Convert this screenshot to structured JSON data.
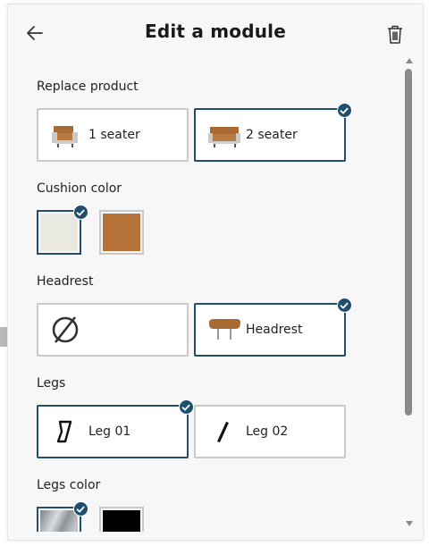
{
  "header": {
    "title": "Edit a module",
    "back_icon": "arrow-left-icon",
    "delete_icon": "trash-icon"
  },
  "sections": {
    "replace_product": {
      "label": "Replace product",
      "options": [
        {
          "label": "1 seater",
          "selected": false
        },
        {
          "label": "2 seater",
          "selected": true
        }
      ]
    },
    "cushion_color": {
      "label": "Cushion color",
      "swatches": [
        {
          "name": "cream-fabric",
          "color": "#e9e9e1",
          "selected": true
        },
        {
          "name": "cognac-leather",
          "color": "#b5733a",
          "selected": false
        }
      ]
    },
    "headrest": {
      "label": "Headrest",
      "options": [
        {
          "label": "",
          "icon": "none-icon",
          "selected": false
        },
        {
          "label": "Headrest",
          "selected": true
        }
      ]
    },
    "legs": {
      "label": "Legs",
      "options": [
        {
          "label": "Leg 01",
          "selected": true
        },
        {
          "label": "Leg 02",
          "selected": false
        }
      ]
    },
    "legs_color": {
      "label": "Legs color",
      "swatches": [
        {
          "name": "chrome",
          "color": "#9fa4a8",
          "selected": true
        },
        {
          "name": "black",
          "color": "#000000",
          "selected": false
        }
      ]
    }
  },
  "colors": {
    "accent": "#1f4e6e",
    "panel_bg": "#f7f7f7",
    "option_border": "#c9c9c9"
  }
}
